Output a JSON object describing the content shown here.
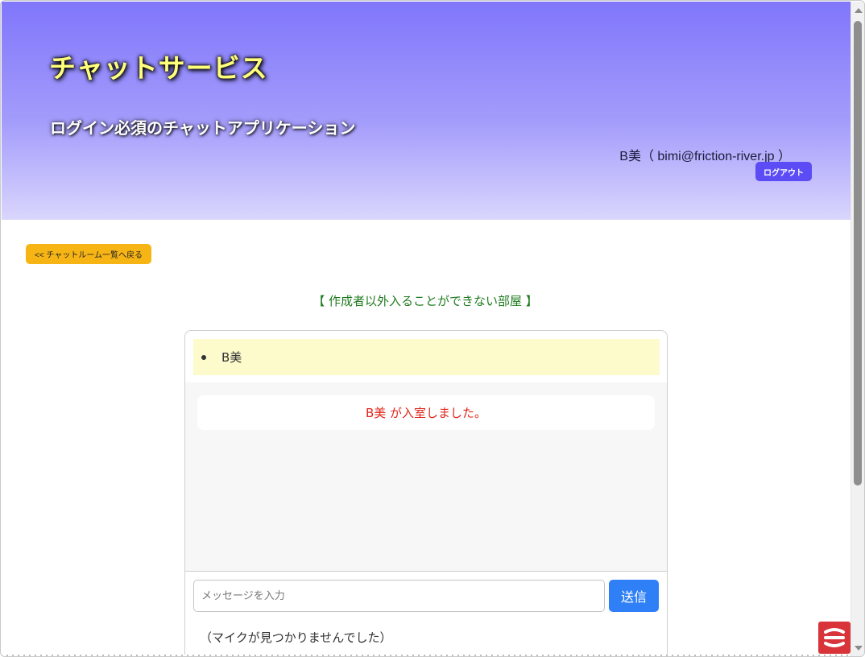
{
  "header": {
    "title": "チャットサービス",
    "subtitle": "ログイン必須のチャットアプリケーション",
    "user_info": "B美（ bimi@friction-river.jp ）",
    "logout_label": "ログアウト"
  },
  "nav": {
    "back_label": "<< チャットルーム一覧へ戻る"
  },
  "room": {
    "title": "【 作成者以外入ることができない部屋 】",
    "members": [
      "B美"
    ],
    "messages": [
      {
        "type": "system",
        "text": "B美 が入室しました。"
      }
    ]
  },
  "composer": {
    "placeholder": "メッセージを入力",
    "value": "",
    "send_label": "送信"
  },
  "mic_status": "（マイクが見つかりませんでした）",
  "colors": {
    "header_gradient_top": "#8076fb",
    "header_gradient_bottom": "#d9d6fd",
    "title_color": "#ffff7a",
    "logout_bg": "#5b4cf5",
    "back_bg": "#f7b515",
    "room_title": "#1e7a1e",
    "system_message": "#e0241b",
    "send_bg": "#2f80f6",
    "member_bg": "#fdfbcc"
  }
}
